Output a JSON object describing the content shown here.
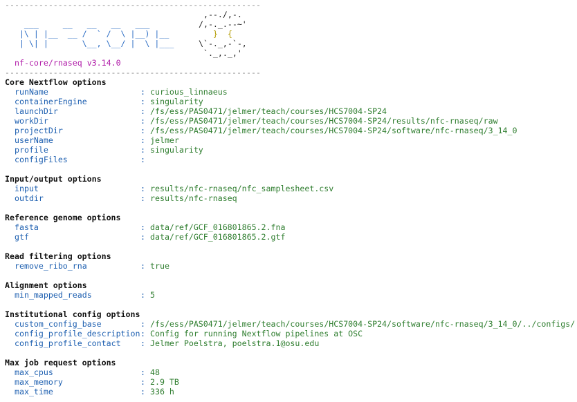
{
  "banner": {
    "divider": "-----------------------------------------------------",
    "logo_left_lines": [
      "",
      "    ___     __   __   __   ___",
      "   |\\ | |__  __ /  ` /  \\ |__) |__",
      "   | \\| |       \\__, \\__/ |  \\ |___",
      ""
    ],
    "logo_right_lines": [
      "  ,--./,-.",
      " /,-._.--~'",
      "    }  {",
      " \\`-._,-`-,",
      "  `._,._,'"
    ],
    "pipeline_version": "nf-core/rnaseq v3.14.0"
  },
  "sections": [
    {
      "title": "Core Nextflow options",
      "options": [
        {
          "key": "runName",
          "value": "curious_linnaeus"
        },
        {
          "key": "containerEngine",
          "value": "singularity"
        },
        {
          "key": "launchDir",
          "value": "/fs/ess/PAS0471/jelmer/teach/courses/HCS7004-SP24"
        },
        {
          "key": "workDir",
          "value": "/fs/ess/PAS0471/jelmer/teach/courses/HCS7004-SP24/results/nfc-rnaseq/raw"
        },
        {
          "key": "projectDir",
          "value": "/fs/ess/PAS0471/jelmer/teach/courses/HCS7004-SP24/software/nfc-rnaseq/3_14_0"
        },
        {
          "key": "userName",
          "value": "jelmer"
        },
        {
          "key": "profile",
          "value": "singularity"
        },
        {
          "key": "configFiles",
          "value": ""
        }
      ]
    },
    {
      "title": "Input/output options",
      "options": [
        {
          "key": "input",
          "value": "results/nfc-rnaseq/nfc_samplesheet.csv"
        },
        {
          "key": "outdir",
          "value": "results/nfc-rnaseq"
        }
      ]
    },
    {
      "title": "Reference genome options",
      "options": [
        {
          "key": "fasta",
          "value": "data/ref/GCF_016801865.2.fna"
        },
        {
          "key": "gtf",
          "value": "data/ref/GCF_016801865.2.gtf"
        }
      ]
    },
    {
      "title": "Read filtering options",
      "options": [
        {
          "key": "remove_ribo_rna",
          "value": "true"
        }
      ]
    },
    {
      "title": "Alignment options",
      "options": [
        {
          "key": "min_mapped_reads",
          "value": "5"
        }
      ]
    },
    {
      "title": "Institutional config options",
      "options": [
        {
          "key": "custom_config_base",
          "value": "/fs/ess/PAS0471/jelmer/teach/courses/HCS7004-SP24/software/nfc-rnaseq/3_14_0/../configs/"
        },
        {
          "key": "config_profile_description",
          "value": "Config for running Nextflow pipelines at OSC"
        },
        {
          "key": "config_profile_contact",
          "value": "Jelmer Poelstra, poelstra.1@osu.edu"
        }
      ]
    },
    {
      "title": "Max job request options",
      "options": [
        {
          "key": "max_cpus",
          "value": "48"
        },
        {
          "key": "max_memory",
          "value": "2.9 TB"
        },
        {
          "key": "max_time",
          "value": "336 h"
        }
      ]
    }
  ],
  "separator": ":",
  "colors": {
    "key": "#1d5fb0",
    "value": "#2e7d2e",
    "version": "#b01aa8",
    "divider": "#8a8a8a",
    "logo_blue": "#2b6cc4",
    "logo_yellow": "#b39b00"
  }
}
